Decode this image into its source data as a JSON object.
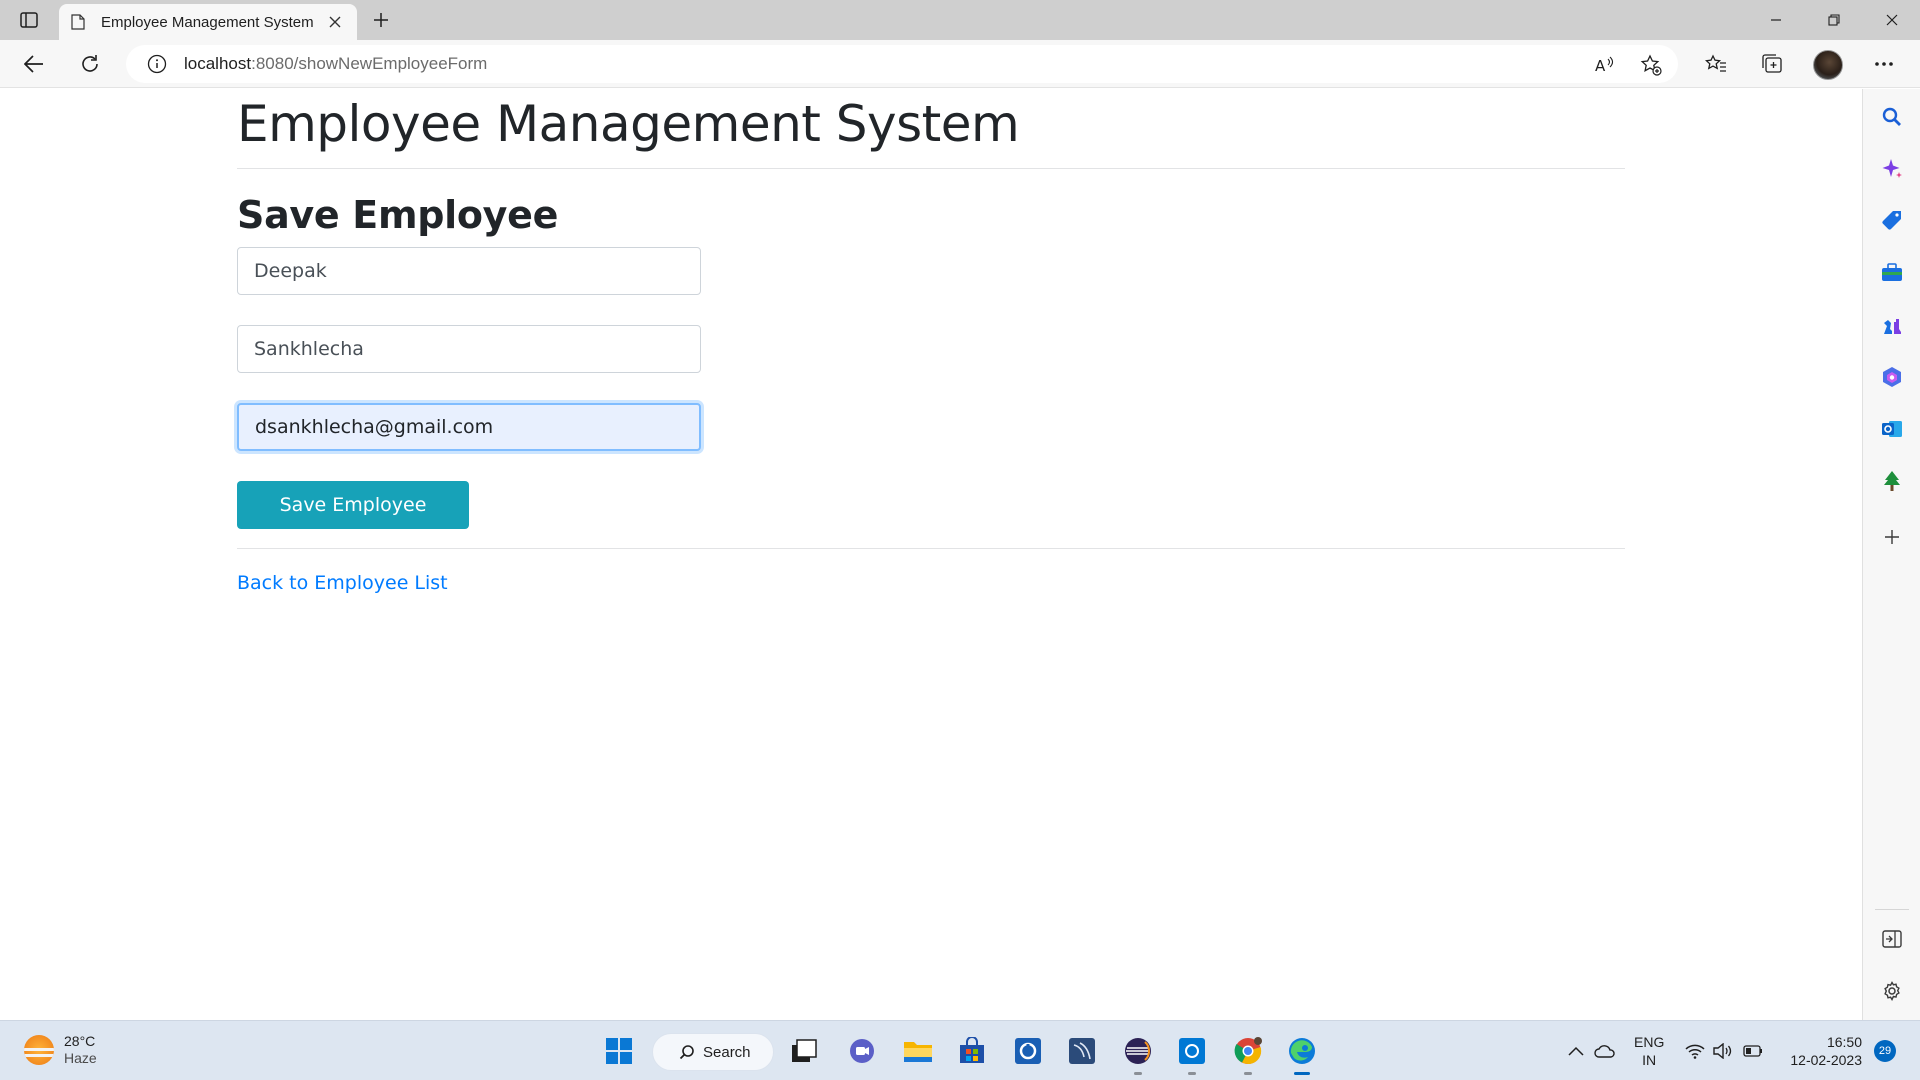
{
  "browser": {
    "tab_title": "Employee Management System",
    "address": {
      "host": "localhost",
      "path": ":8080/showNewEmployeeForm"
    }
  },
  "page": {
    "heading": "Employee Management System",
    "form_title": "Save Employee",
    "fields": {
      "first_name": "Deepak",
      "last_name": "Sankhlecha",
      "email": "dsankhlecha@gmail.com"
    },
    "save_button": "Save Employee",
    "back_link": "Back to Employee List"
  },
  "taskbar": {
    "weather": {
      "temp": "28°C",
      "condition": "Haze"
    },
    "search_label": "Search",
    "language": {
      "lang": "ENG",
      "region": "IN"
    },
    "clock": {
      "time": "16:50",
      "date": "12-02-2023"
    },
    "notification_count": "29"
  },
  "colors": {
    "primary_button": "#17a2b8",
    "link": "#007bff",
    "focus_bg": "#e8f0fe"
  }
}
